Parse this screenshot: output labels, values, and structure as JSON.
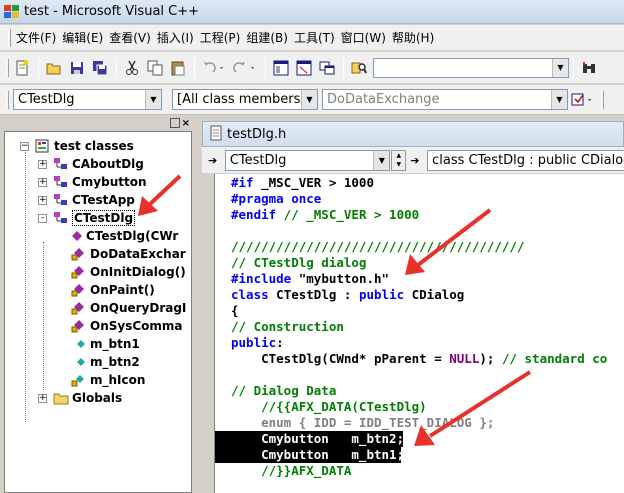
{
  "window": {
    "title": "test - Microsoft Visual C++"
  },
  "menu": {
    "items": [
      "文件(F)",
      "编辑(E)",
      "查看(V)",
      "插入(I)",
      "工程(P)",
      "组建(B)",
      "工具(T)",
      "窗口(W)",
      "帮助(H)"
    ]
  },
  "toolbar": {
    "find_value": ""
  },
  "wizard": {
    "class_combo": "CTestDlg",
    "filter_combo": "[All class members]",
    "member_combo": "DoDataExchange"
  },
  "classview": {
    "root": "test classes",
    "items": [
      {
        "label": "CAboutDlg",
        "icon": "class-icon",
        "expander": "+"
      },
      {
        "label": "Cmybutton",
        "icon": "class-icon",
        "expander": "+"
      },
      {
        "label": "CTestApp",
        "icon": "class-icon",
        "expander": "+"
      },
      {
        "label": "CTestDlg",
        "icon": "class-icon",
        "expander": "-"
      },
      {
        "label": "CTestDlg(CWr",
        "icon": "method-icon"
      },
      {
        "label": "DoDataExchar",
        "icon": "protected-method-icon"
      },
      {
        "label": "OnInitDialog()",
        "icon": "protected-method-icon"
      },
      {
        "label": "OnPaint()",
        "icon": "protected-method-icon"
      },
      {
        "label": "OnQueryDragI",
        "icon": "protected-method-icon"
      },
      {
        "label": "OnSysComma",
        "icon": "protected-method-icon"
      },
      {
        "label": "m_btn1",
        "icon": "member-icon"
      },
      {
        "label": "m_btn2",
        "icon": "member-icon"
      },
      {
        "label": "m_hIcon",
        "icon": "protected-member-icon"
      },
      {
        "label": "Globals",
        "icon": "folder-icon",
        "expander": "+"
      }
    ]
  },
  "editor": {
    "doc_title": "testDlg.h",
    "scope_combo": "CTestDlg",
    "declaration": "class CTestDlg : public CDialog"
  },
  "code": {
    "l1_a": "#if",
    "l1_b": " _MSC_VER > 1000",
    "l2_a": "#pragma once",
    "l3_a": "#endif",
    "l3_b": " // _MSC_VER > 1000",
    "l4": "///////////////////////////////////////",
    "l5": "// CTestDlg dialog",
    "l6_a": "#include",
    "l6_b": " \"mybutton.h\"",
    "l7_a": "class",
    "l7_b": " CTestDlg : ",
    "l7_c": "public",
    "l7_d": " CDialog",
    "l8": "{",
    "l9": "// Construction",
    "l10_a": "public",
    "l10_b": ":",
    "l11_a": "    CTestDlg(CWnd* pParent = ",
    "l11_b": "NULL",
    "l11_c": "); ",
    "l11_d": "// standard co",
    "l12": "// Dialog Data",
    "l13": "    //{{AFX_DATA(CTestDlg)",
    "l14": "    enum { IDD = IDD_TEST_DIALOG };",
    "l15": "    Cmybutton   m_btn2;",
    "l16": "    Cmybutton   m_btn1;",
    "l17": "    //}}AFX_DATA"
  },
  "colors": {
    "keyword": "#0000ff",
    "comment": "#008000",
    "annotation": "#e8312a"
  }
}
